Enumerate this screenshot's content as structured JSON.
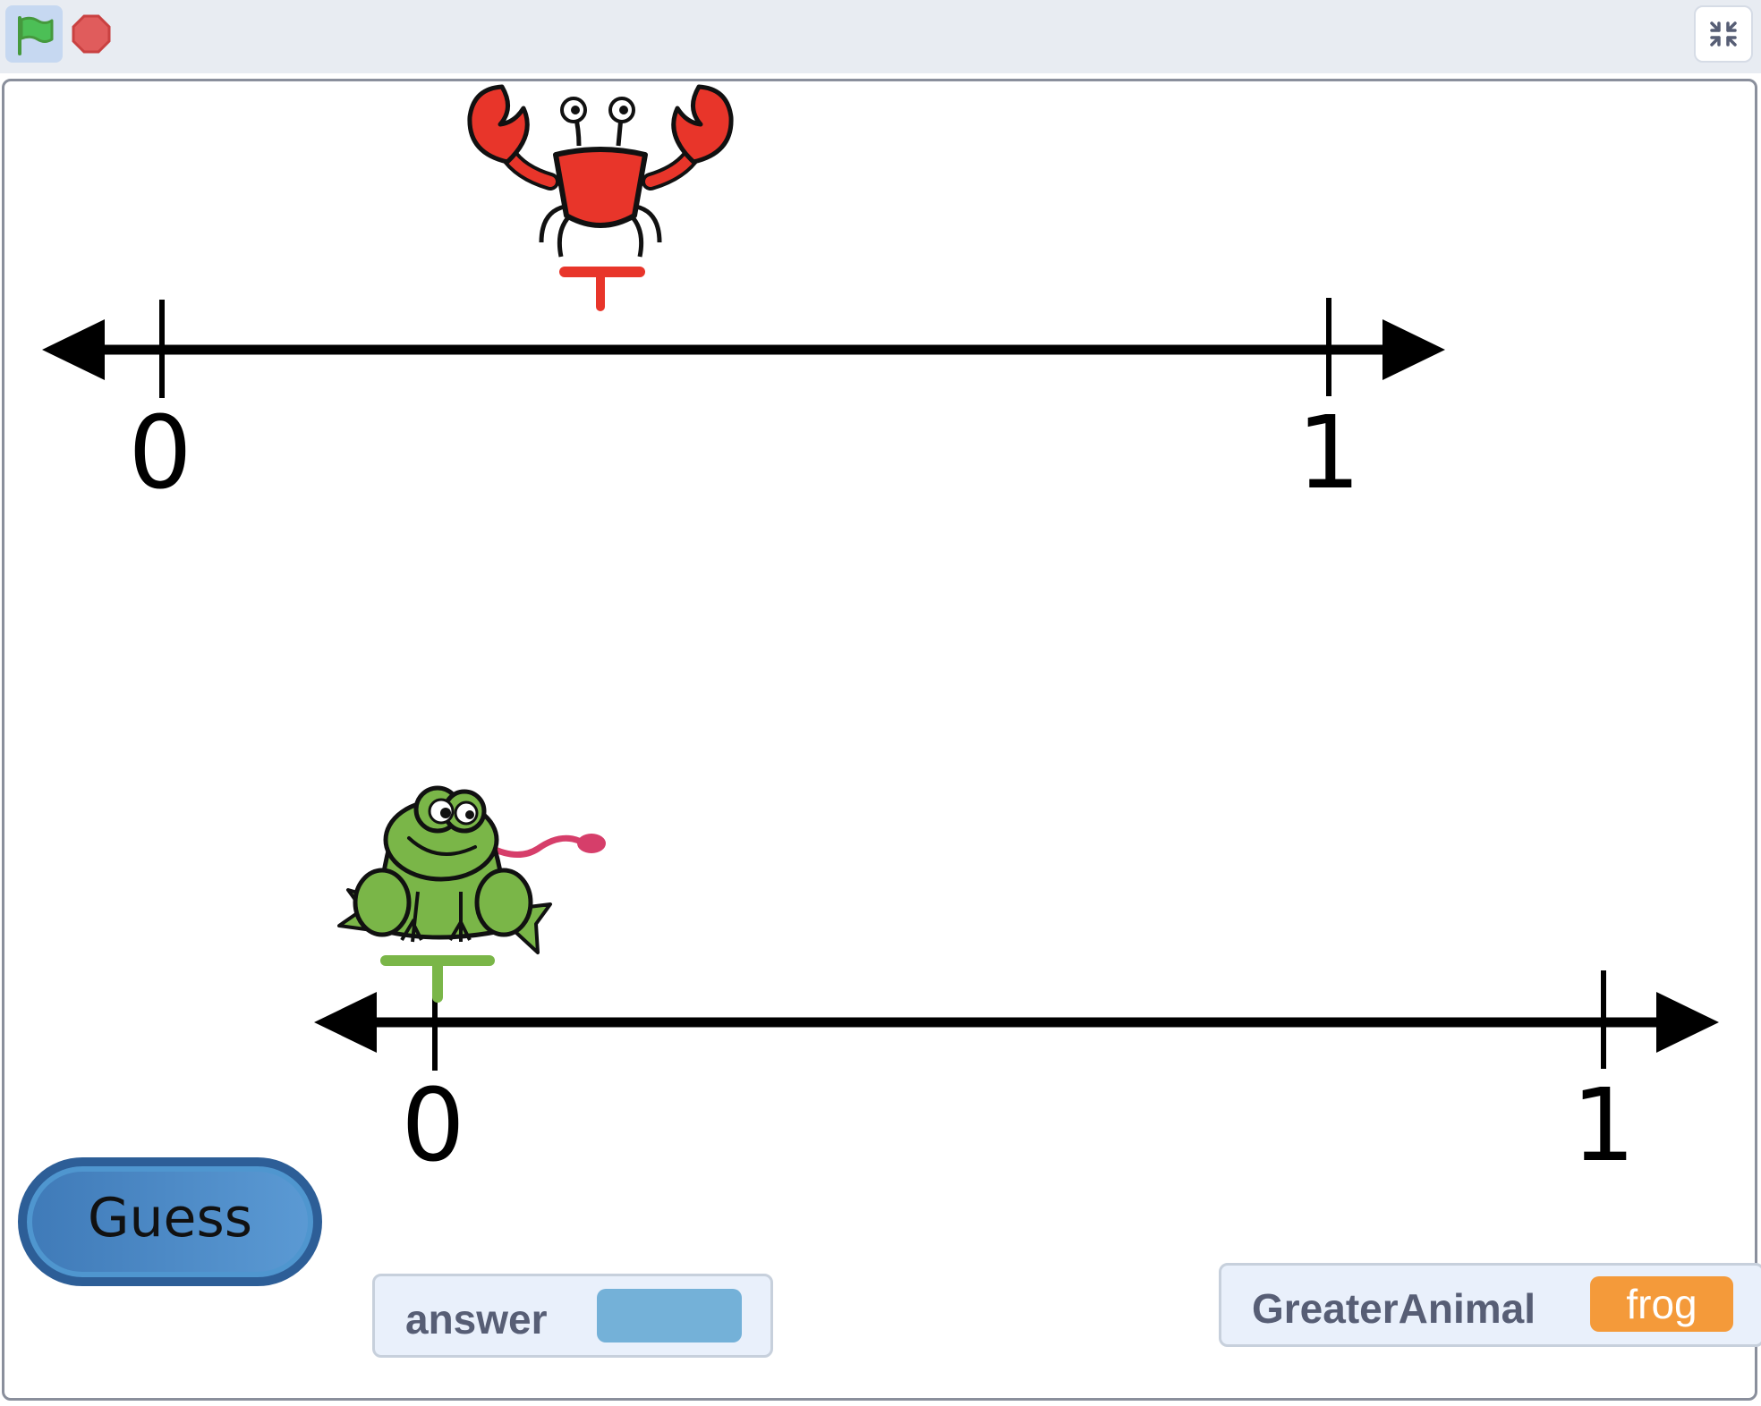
{
  "toolbar": {
    "green_flag_icon": "green-flag-icon",
    "stop_icon": "stop-icon",
    "fullscreen_exit_icon": "fullscreen-exit-icon"
  },
  "stage": {
    "top_number_line": {
      "start_label": "0",
      "end_label": "1"
    },
    "bottom_number_line": {
      "start_label": "0",
      "end_label": "1"
    },
    "sprites": {
      "crab": {
        "name": "crab",
        "marker_color": "#e8352a"
      },
      "frog": {
        "name": "frog",
        "marker_color": "#7ab648"
      }
    },
    "guess_button": {
      "label": "Guess"
    },
    "monitors": {
      "answer": {
        "label": "answer",
        "value": ""
      },
      "greater_animal": {
        "label": "GreaterAnimal",
        "value": "frog"
      }
    }
  },
  "colors": {
    "toolbar_bg": "#e8ecf2",
    "guess_blue": "#3f7ab8",
    "answer_value_bg": "#74b1d8",
    "animal_value_bg": "#f49a3a",
    "monitor_label": "#575e75"
  }
}
